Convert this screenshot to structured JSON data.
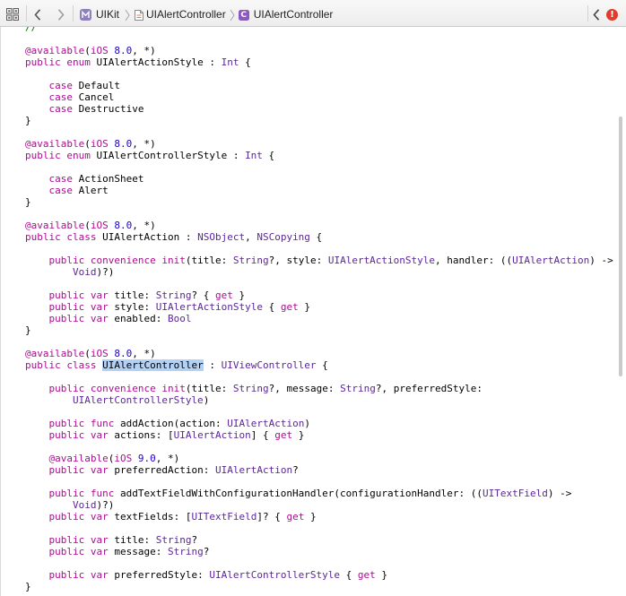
{
  "jump_bar": {
    "related_items_icon": "grid-icon",
    "back_icon": "chevron-left-icon",
    "forward_icon": "chevron-right-icon",
    "path": [
      {
        "label": "UIKit",
        "icon": "framework-icon"
      },
      {
        "label": "UIAlertController",
        "icon": "swift-file-icon"
      },
      {
        "label": "UIAlertController",
        "icon": "class-icon",
        "icon_letter": "C"
      }
    ],
    "issues": {
      "back_icon": "chevron-left-icon",
      "status_icon": "error-icon",
      "status_symbol": "!"
    },
    "colors": {
      "framework_icon": "#8f7fbd",
      "class_icon": "#8b59c0",
      "error_icon": "#e23b2e"
    }
  },
  "editor": {
    "syntax_colors": {
      "kw": "#aa0d91",
      "ty": "#5c2699",
      "num": "#1c00cf",
      "com": "#007400",
      "pl": "#000000",
      "sel": "#000000",
      "selection_background": "#b3d1f5"
    },
    "lines": [
      {
        "tokens": [
          {
            "k": "com",
            "t": "//"
          }
        ]
      },
      {
        "tokens": []
      },
      {
        "tokens": [
          {
            "k": "kw",
            "t": "@available"
          },
          {
            "k": "pl",
            "t": "("
          },
          {
            "k": "kw",
            "t": "iOS"
          },
          {
            "k": "pl",
            "t": " "
          },
          {
            "k": "num",
            "t": "8.0"
          },
          {
            "k": "pl",
            "t": ", *)"
          }
        ]
      },
      {
        "tokens": [
          {
            "k": "kw",
            "t": "public"
          },
          {
            "k": "pl",
            "t": " "
          },
          {
            "k": "kw",
            "t": "enum"
          },
          {
            "k": "pl",
            "t": " UIAlertActionStyle : "
          },
          {
            "k": "ty",
            "t": "Int"
          },
          {
            "k": "pl",
            "t": " {"
          }
        ]
      },
      {
        "tokens": []
      },
      {
        "tokens": [
          {
            "k": "pl",
            "t": "    "
          },
          {
            "k": "kw",
            "t": "case"
          },
          {
            "k": "pl",
            "t": " Default"
          }
        ]
      },
      {
        "tokens": [
          {
            "k": "pl",
            "t": "    "
          },
          {
            "k": "kw",
            "t": "case"
          },
          {
            "k": "pl",
            "t": " Cancel"
          }
        ]
      },
      {
        "tokens": [
          {
            "k": "pl",
            "t": "    "
          },
          {
            "k": "kw",
            "t": "case"
          },
          {
            "k": "pl",
            "t": " Destructive"
          }
        ]
      },
      {
        "tokens": [
          {
            "k": "pl",
            "t": "}"
          }
        ]
      },
      {
        "tokens": []
      },
      {
        "tokens": [
          {
            "k": "kw",
            "t": "@available"
          },
          {
            "k": "pl",
            "t": "("
          },
          {
            "k": "kw",
            "t": "iOS"
          },
          {
            "k": "pl",
            "t": " "
          },
          {
            "k": "num",
            "t": "8.0"
          },
          {
            "k": "pl",
            "t": ", *)"
          }
        ]
      },
      {
        "tokens": [
          {
            "k": "kw",
            "t": "public"
          },
          {
            "k": "pl",
            "t": " "
          },
          {
            "k": "kw",
            "t": "enum"
          },
          {
            "k": "pl",
            "t": " UIAlertControllerStyle : "
          },
          {
            "k": "ty",
            "t": "Int"
          },
          {
            "k": "pl",
            "t": " {"
          }
        ]
      },
      {
        "tokens": []
      },
      {
        "tokens": [
          {
            "k": "pl",
            "t": "    "
          },
          {
            "k": "kw",
            "t": "case"
          },
          {
            "k": "pl",
            "t": " ActionSheet"
          }
        ]
      },
      {
        "tokens": [
          {
            "k": "pl",
            "t": "    "
          },
          {
            "k": "kw",
            "t": "case"
          },
          {
            "k": "pl",
            "t": " Alert"
          }
        ]
      },
      {
        "tokens": [
          {
            "k": "pl",
            "t": "}"
          }
        ]
      },
      {
        "tokens": []
      },
      {
        "tokens": [
          {
            "k": "kw",
            "t": "@available"
          },
          {
            "k": "pl",
            "t": "("
          },
          {
            "k": "kw",
            "t": "iOS"
          },
          {
            "k": "pl",
            "t": " "
          },
          {
            "k": "num",
            "t": "8.0"
          },
          {
            "k": "pl",
            "t": ", *)"
          }
        ]
      },
      {
        "tokens": [
          {
            "k": "kw",
            "t": "public"
          },
          {
            "k": "pl",
            "t": " "
          },
          {
            "k": "kw",
            "t": "class"
          },
          {
            "k": "pl",
            "t": " UIAlertAction : "
          },
          {
            "k": "ty",
            "t": "NSObject"
          },
          {
            "k": "pl",
            "t": ", "
          },
          {
            "k": "ty",
            "t": "NSCopying"
          },
          {
            "k": "pl",
            "t": " {"
          }
        ]
      },
      {
        "tokens": []
      },
      {
        "tokens": [
          {
            "k": "pl",
            "t": "    "
          },
          {
            "k": "kw",
            "t": "public"
          },
          {
            "k": "pl",
            "t": " "
          },
          {
            "k": "kw",
            "t": "convenience"
          },
          {
            "k": "pl",
            "t": " "
          },
          {
            "k": "kw",
            "t": "init"
          },
          {
            "k": "pl",
            "t": "(title: "
          },
          {
            "k": "ty",
            "t": "String"
          },
          {
            "k": "pl",
            "t": "?, style: "
          },
          {
            "k": "ty",
            "t": "UIAlertActionStyle"
          },
          {
            "k": "pl",
            "t": ", handler: (("
          },
          {
            "k": "ty",
            "t": "UIAlertAction"
          },
          {
            "k": "pl",
            "t": ") ->"
          }
        ]
      },
      {
        "tokens": [
          {
            "k": "pl",
            "t": "        "
          },
          {
            "k": "ty",
            "t": "Void"
          },
          {
            "k": "pl",
            "t": ")?)"
          }
        ]
      },
      {
        "tokens": []
      },
      {
        "tokens": [
          {
            "k": "pl",
            "t": "    "
          },
          {
            "k": "kw",
            "t": "public"
          },
          {
            "k": "pl",
            "t": " "
          },
          {
            "k": "kw",
            "t": "var"
          },
          {
            "k": "pl",
            "t": " title: "
          },
          {
            "k": "ty",
            "t": "String"
          },
          {
            "k": "pl",
            "t": "? { "
          },
          {
            "k": "kw",
            "t": "get"
          },
          {
            "k": "pl",
            "t": " }"
          }
        ]
      },
      {
        "tokens": [
          {
            "k": "pl",
            "t": "    "
          },
          {
            "k": "kw",
            "t": "public"
          },
          {
            "k": "pl",
            "t": " "
          },
          {
            "k": "kw",
            "t": "var"
          },
          {
            "k": "pl",
            "t": " style: "
          },
          {
            "k": "ty",
            "t": "UIAlertActionStyle"
          },
          {
            "k": "pl",
            "t": " { "
          },
          {
            "k": "kw",
            "t": "get"
          },
          {
            "k": "pl",
            "t": " }"
          }
        ]
      },
      {
        "tokens": [
          {
            "k": "pl",
            "t": "    "
          },
          {
            "k": "kw",
            "t": "public"
          },
          {
            "k": "pl",
            "t": " "
          },
          {
            "k": "kw",
            "t": "var"
          },
          {
            "k": "pl",
            "t": " enabled: "
          },
          {
            "k": "ty",
            "t": "Bool"
          }
        ]
      },
      {
        "tokens": [
          {
            "k": "pl",
            "t": "}"
          }
        ]
      },
      {
        "tokens": []
      },
      {
        "tokens": [
          {
            "k": "kw",
            "t": "@available"
          },
          {
            "k": "pl",
            "t": "("
          },
          {
            "k": "kw",
            "t": "iOS"
          },
          {
            "k": "pl",
            "t": " "
          },
          {
            "k": "num",
            "t": "8.0"
          },
          {
            "k": "pl",
            "t": ", *)"
          }
        ]
      },
      {
        "tokens": [
          {
            "k": "kw",
            "t": "public"
          },
          {
            "k": "pl",
            "t": " "
          },
          {
            "k": "kw",
            "t": "class"
          },
          {
            "k": "pl",
            "t": " "
          },
          {
            "k": "sel",
            "t": "UIAlertController"
          },
          {
            "k": "pl",
            "t": " : "
          },
          {
            "k": "ty",
            "t": "UIViewController"
          },
          {
            "k": "pl",
            "t": " {"
          }
        ]
      },
      {
        "tokens": []
      },
      {
        "tokens": [
          {
            "k": "pl",
            "t": "    "
          },
          {
            "k": "kw",
            "t": "public"
          },
          {
            "k": "pl",
            "t": " "
          },
          {
            "k": "kw",
            "t": "convenience"
          },
          {
            "k": "pl",
            "t": " "
          },
          {
            "k": "kw",
            "t": "init"
          },
          {
            "k": "pl",
            "t": "(title: "
          },
          {
            "k": "ty",
            "t": "String"
          },
          {
            "k": "pl",
            "t": "?, message: "
          },
          {
            "k": "ty",
            "t": "String"
          },
          {
            "k": "pl",
            "t": "?, preferredStyle:"
          }
        ]
      },
      {
        "tokens": [
          {
            "k": "pl",
            "t": "        "
          },
          {
            "k": "ty",
            "t": "UIAlertControllerStyle"
          },
          {
            "k": "pl",
            "t": ")"
          }
        ]
      },
      {
        "tokens": []
      },
      {
        "tokens": [
          {
            "k": "pl",
            "t": "    "
          },
          {
            "k": "kw",
            "t": "public"
          },
          {
            "k": "pl",
            "t": " "
          },
          {
            "k": "kw",
            "t": "func"
          },
          {
            "k": "pl",
            "t": " addAction(action: "
          },
          {
            "k": "ty",
            "t": "UIAlertAction"
          },
          {
            "k": "pl",
            "t": ")"
          }
        ]
      },
      {
        "tokens": [
          {
            "k": "pl",
            "t": "    "
          },
          {
            "k": "kw",
            "t": "public"
          },
          {
            "k": "pl",
            "t": " "
          },
          {
            "k": "kw",
            "t": "var"
          },
          {
            "k": "pl",
            "t": " actions: ["
          },
          {
            "k": "ty",
            "t": "UIAlertAction"
          },
          {
            "k": "pl",
            "t": "] { "
          },
          {
            "k": "kw",
            "t": "get"
          },
          {
            "k": "pl",
            "t": " }"
          }
        ]
      },
      {
        "tokens": []
      },
      {
        "tokens": [
          {
            "k": "pl",
            "t": "    "
          },
          {
            "k": "kw",
            "t": "@available"
          },
          {
            "k": "pl",
            "t": "("
          },
          {
            "k": "kw",
            "t": "iOS"
          },
          {
            "k": "pl",
            "t": " "
          },
          {
            "k": "num",
            "t": "9.0"
          },
          {
            "k": "pl",
            "t": ", *)"
          }
        ]
      },
      {
        "tokens": [
          {
            "k": "pl",
            "t": "    "
          },
          {
            "k": "kw",
            "t": "public"
          },
          {
            "k": "pl",
            "t": " "
          },
          {
            "k": "kw",
            "t": "var"
          },
          {
            "k": "pl",
            "t": " preferredAction: "
          },
          {
            "k": "ty",
            "t": "UIAlertAction"
          },
          {
            "k": "pl",
            "t": "?"
          }
        ]
      },
      {
        "tokens": []
      },
      {
        "tokens": [
          {
            "k": "pl",
            "t": "    "
          },
          {
            "k": "kw",
            "t": "public"
          },
          {
            "k": "pl",
            "t": " "
          },
          {
            "k": "kw",
            "t": "func"
          },
          {
            "k": "pl",
            "t": " addTextFieldWithConfigurationHandler(configurationHandler: (("
          },
          {
            "k": "ty",
            "t": "UITextField"
          },
          {
            "k": "pl",
            "t": ") ->"
          }
        ]
      },
      {
        "tokens": [
          {
            "k": "pl",
            "t": "        "
          },
          {
            "k": "ty",
            "t": "Void"
          },
          {
            "k": "pl",
            "t": ")?)"
          }
        ]
      },
      {
        "tokens": [
          {
            "k": "pl",
            "t": "    "
          },
          {
            "k": "kw",
            "t": "public"
          },
          {
            "k": "pl",
            "t": " "
          },
          {
            "k": "kw",
            "t": "var"
          },
          {
            "k": "pl",
            "t": " textFields: ["
          },
          {
            "k": "ty",
            "t": "UITextField"
          },
          {
            "k": "pl",
            "t": "]? { "
          },
          {
            "k": "kw",
            "t": "get"
          },
          {
            "k": "pl",
            "t": " }"
          }
        ]
      },
      {
        "tokens": []
      },
      {
        "tokens": [
          {
            "k": "pl",
            "t": "    "
          },
          {
            "k": "kw",
            "t": "public"
          },
          {
            "k": "pl",
            "t": " "
          },
          {
            "k": "kw",
            "t": "var"
          },
          {
            "k": "pl",
            "t": " title: "
          },
          {
            "k": "ty",
            "t": "String"
          },
          {
            "k": "pl",
            "t": "?"
          }
        ]
      },
      {
        "tokens": [
          {
            "k": "pl",
            "t": "    "
          },
          {
            "k": "kw",
            "t": "public"
          },
          {
            "k": "pl",
            "t": " "
          },
          {
            "k": "kw",
            "t": "var"
          },
          {
            "k": "pl",
            "t": " message: "
          },
          {
            "k": "ty",
            "t": "String"
          },
          {
            "k": "pl",
            "t": "?"
          }
        ]
      },
      {
        "tokens": []
      },
      {
        "tokens": [
          {
            "k": "pl",
            "t": "    "
          },
          {
            "k": "kw",
            "t": "public"
          },
          {
            "k": "pl",
            "t": " "
          },
          {
            "k": "kw",
            "t": "var"
          },
          {
            "k": "pl",
            "t": " preferredStyle: "
          },
          {
            "k": "ty",
            "t": "UIAlertControllerStyle"
          },
          {
            "k": "pl",
            "t": " { "
          },
          {
            "k": "kw",
            "t": "get"
          },
          {
            "k": "pl",
            "t": " }"
          }
        ]
      },
      {
        "tokens": [
          {
            "k": "pl",
            "t": "}"
          }
        ]
      }
    ]
  }
}
